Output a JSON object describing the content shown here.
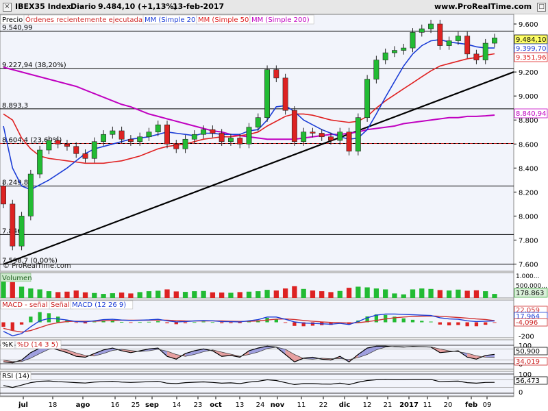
{
  "header": {
    "symbol": "IBEX35 Index",
    "period": "Diario",
    "last": "9.484,10 (+1,13%)",
    "date": "13-feb-2017",
    "site": "www.ProRealTime.com"
  },
  "watermark": "© ProRealTime.com",
  "price_panel": {
    "legend": {
      "precio": "Precio",
      "orders": "Órdenes recientemente ejecutadas",
      "mm20": "MM (Simple 20)",
      "mm50": "MM (Simple 50)",
      "mm200": "MM (Simple 200)"
    },
    "levels": [
      {
        "label": "9.540,99",
        "value": 9541
      },
      {
        "label": "9.227,94",
        "value": 9228,
        "fib": "(38,20%)"
      },
      {
        "label": "8.893,3",
        "value": 8893
      },
      {
        "label": "8.604,4",
        "value": 8604,
        "fib": "(23,60%)"
      },
      {
        "label": "8.249,89",
        "value": 8250
      },
      {
        "label": "7.846",
        "value": 7846
      },
      {
        "label": "7.598,7",
        "value": 7599,
        "fib": "(0,00%)"
      }
    ],
    "yticks": [
      "9.600",
      "9.400",
      "9.200",
      "9.000",
      "8.800",
      "8.600",
      "8.400",
      "8.200",
      "8.000",
      "7.800",
      "7.600"
    ],
    "value_tags": [
      {
        "text": "9.484,10",
        "color": "#000000",
        "bg": "#ffff66"
      },
      {
        "text": "9.399,70",
        "color": "#1a3cd6",
        "bg": "#ffffff"
      },
      {
        "text": "9.351,96",
        "color": "#e02020",
        "bg": "#ffffff"
      },
      {
        "text": "8.840,94",
        "color": "#c000c0",
        "bg": "#ffffff"
      }
    ]
  },
  "volume_panel": {
    "label": "Volumen",
    "yticks": [
      "1.000...",
      "500.000..."
    ],
    "value_tag": "178.863"
  },
  "macd_panel": {
    "legend": {
      "hist": "MACD - señal",
      "signal": "Señal",
      "macd": "MACD (12 26 9)"
    },
    "yticks": [
      "200",
      "0",
      "-200"
    ],
    "value_tags": [
      "22,059",
      "17,964",
      "-4,096"
    ]
  },
  "stoch_panel": {
    "legend": {
      "k": "%K",
      "d": "%D (14 3 5)"
    },
    "yticks": [
      "100",
      "0"
    ],
    "value_tags": [
      "50,900",
      "34,019"
    ]
  },
  "rsi_panel": {
    "legend": {
      "rsi": "RSI (14)"
    },
    "yticks": [
      "100",
      "0"
    ],
    "value_tag": "56,473"
  },
  "xaxis": {
    "labels": [
      "jul",
      "18",
      "ago",
      "16",
      "25",
      "sep",
      "14",
      "23",
      "oct",
      "13",
      "24",
      "nov",
      "11",
      "22",
      "dic",
      "12",
      "21",
      "2017",
      "11",
      "20",
      "feb",
      "09"
    ],
    "bold": [
      "jul",
      "ago",
      "sep",
      "oct",
      "nov",
      "dic",
      "2017",
      "feb"
    ]
  },
  "colors": {
    "up": "#22bb33",
    "down": "#dd2222",
    "mm20": "#1a3cd6",
    "mm50": "#e02020",
    "mm200": "#c000c0",
    "trend": "#000000"
  },
  "chart_data": {
    "type": "candlestick",
    "x": [
      "2016-06-27",
      "2016-06-30",
      "2016-07-05",
      "2016-07-08",
      "2016-07-13",
      "2016-07-18",
      "2016-07-21",
      "2016-07-26",
      "2016-07-29",
      "2016-08-03",
      "2016-08-08",
      "2016-08-11",
      "2016-08-16",
      "2016-08-19",
      "2016-08-24",
      "2016-08-29",
      "2016-09-01",
      "2016-09-06",
      "2016-09-09",
      "2016-09-14",
      "2016-09-19",
      "2016-09-22",
      "2016-09-27",
      "2016-09-30",
      "2016-10-05",
      "2016-10-10",
      "2016-10-13",
      "2016-10-18",
      "2016-10-21",
      "2016-10-26",
      "2016-10-31",
      "2016-11-03",
      "2016-11-08",
      "2016-11-11",
      "2016-11-16",
      "2016-11-21",
      "2016-11-24",
      "2016-11-29",
      "2016-12-02",
      "2016-12-07",
      "2016-12-12",
      "2016-12-15",
      "2016-12-20",
      "2016-12-23",
      "2016-12-29",
      "2017-01-04",
      "2017-01-09",
      "2017-01-12",
      "2017-01-17",
      "2017-01-20",
      "2017-01-25",
      "2017-01-30",
      "2017-02-02",
      "2017-02-07",
      "2017-02-13"
    ],
    "close": [
      8100,
      7750,
      8000,
      8350,
      8550,
      8630,
      8600,
      8580,
      8520,
      8480,
      8620,
      8680,
      8710,
      8640,
      8620,
      8660,
      8700,
      8760,
      8600,
      8560,
      8640,
      8680,
      8720,
      8690,
      8620,
      8650,
      8600,
      8740,
      8820,
      9220,
      9150,
      8880,
      8620,
      8700,
      8690,
      8660,
      8630,
      8700,
      8540,
      8820,
      9140,
      9300,
      9360,
      9380,
      9400,
      9530,
      9560,
      9600,
      9420,
      9460,
      9500,
      9350,
      9300,
      9440,
      9484
    ],
    "mm20": [
      8750,
      8400,
      8250,
      8220,
      8260,
      8300,
      8350,
      8400,
      8460,
      8520,
      8560,
      8580,
      8600,
      8620,
      8640,
      8650,
      8660,
      8680,
      8700,
      8690,
      8680,
      8670,
      8690,
      8690,
      8680,
      8680,
      8680,
      8710,
      8720,
      8800,
      8910,
      8920,
      8870,
      8800,
      8760,
      8720,
      8690,
      8660,
      8640,
      8650,
      8720,
      8850,
      8990,
      9120,
      9250,
      9350,
      9420,
      9460,
      9470,
      9450,
      9440,
      9430,
      9410,
      9400,
      9400
    ],
    "mm50": [
      8850,
      8800,
      8650,
      8560,
      8500,
      8480,
      8470,
      8460,
      8450,
      8440,
      8440,
      8440,
      8450,
      8460,
      8480,
      8500,
      8530,
      8560,
      8580,
      8590,
      8600,
      8620,
      8640,
      8650,
      8660,
      8660,
      8670,
      8680,
      8700,
      8750,
      8790,
      8830,
      8850,
      8850,
      8840,
      8820,
      8800,
      8790,
      8780,
      8790,
      8830,
      8900,
      8960,
      9010,
      9060,
      9110,
      9160,
      9210,
      9250,
      9270,
      9290,
      9310,
      9320,
      9340,
      9352
    ],
    "mm200": [
      9240,
      9220,
      9200,
      9180,
      9160,
      9140,
      9120,
      9100,
      9080,
      9050,
      9020,
      8990,
      8960,
      8930,
      8910,
      8880,
      8850,
      8830,
      8810,
      8790,
      8770,
      8750,
      8730,
      8710,
      8700,
      8680,
      8670,
      8660,
      8650,
      8640,
      8640,
      8640,
      8640,
      8650,
      8660,
      8670,
      8680,
      8680,
      8690,
      8700,
      8720,
      8730,
      8740,
      8750,
      8770,
      8780,
      8790,
      8800,
      8810,
      8820,
      8820,
      8830,
      8830,
      8835,
      8841
    ],
    "trendline": {
      "x": [
        "2016-06-27",
        "2017-02-13"
      ],
      "y": [
        7598.7,
        9140
      ]
    },
    "ylim": [
      7540,
      9680
    ],
    "volume": [
      900000,
      700000,
      500000,
      420000,
      380000,
      300000,
      260000,
      280000,
      330000,
      250000,
      220000,
      180000,
      210000,
      240000,
      200000,
      260000,
      300000,
      320000,
      380000,
      290000,
      270000,
      300000,
      310000,
      250000,
      240000,
      230000,
      260000,
      280000,
      300000,
      360000,
      330000,
      420000,
      520000,
      400000,
      330000,
      300000,
      260000,
      310000,
      450000,
      500000,
      470000,
      420000,
      380000,
      200000,
      160000,
      380000,
      420000,
      400000,
      350000,
      330000,
      370000,
      320000,
      340000,
      300000,
      178863
    ],
    "macd": [
      -120,
      -180,
      -150,
      -60,
      20,
      50,
      45,
      30,
      10,
      5,
      20,
      35,
      40,
      30,
      25,
      28,
      32,
      40,
      20,
      5,
      10,
      18,
      24,
      20,
      10,
      8,
      5,
      20,
      35,
      70,
      70,
      40,
      5,
      -10,
      -15,
      -20,
      -25,
      -15,
      -30,
      10,
      60,
      95,
      110,
      110,
      105,
      100,
      95,
      90,
      60,
      45,
      40,
      20,
      10,
      15,
      17.964
    ],
    "signal": [
      -80,
      -110,
      -130,
      -110,
      -70,
      -30,
      -5,
      10,
      15,
      15,
      15,
      20,
      25,
      28,
      28,
      27,
      28,
      30,
      28,
      22,
      18,
      17,
      18,
      19,
      18,
      15,
      12,
      13,
      18,
      30,
      42,
      45,
      37,
      25,
      15,
      5,
      -2,
      -5,
      -10,
      -6,
      8,
      25,
      45,
      60,
      70,
      78,
      82,
      84,
      80,
      72,
      64,
      55,
      45,
      37,
      22.059
    ],
    "stoch_k": [
      10,
      5,
      20,
      60,
      85,
      90,
      75,
      60,
      40,
      35,
      55,
      75,
      85,
      70,
      60,
      70,
      80,
      85,
      40,
      25,
      55,
      70,
      80,
      70,
      40,
      45,
      35,
      70,
      85,
      95,
      90,
      50,
      10,
      30,
      35,
      25,
      20,
      40,
      10,
      50,
      85,
      95,
      95,
      92,
      90,
      93,
      92,
      90,
      60,
      65,
      70,
      35,
      25,
      45,
      50.9
    ],
    "stoch_d": [
      20,
      12,
      12,
      30,
      55,
      78,
      85,
      75,
      58,
      45,
      42,
      55,
      72,
      78,
      72,
      66,
      70,
      78,
      68,
      50,
      40,
      50,
      65,
      75,
      63,
      52,
      40,
      50,
      63,
      82,
      90,
      78,
      50,
      28,
      25,
      30,
      27,
      28,
      23,
      33,
      50,
      75,
      90,
      94,
      92,
      91,
      92,
      91,
      80,
      70,
      65,
      57,
      43,
      35,
      34.019
    ],
    "rsi": [
      40,
      30,
      42,
      55,
      62,
      64,
      60,
      58,
      55,
      53,
      58,
      60,
      62,
      58,
      56,
      58,
      60,
      62,
      52,
      50,
      55,
      57,
      59,
      56,
      52,
      54,
      50,
      58,
      62,
      70,
      66,
      55,
      45,
      50,
      50,
      48,
      47,
      52,
      45,
      57,
      66,
      70,
      72,
      70,
      70,
      72,
      72,
      72,
      60,
      62,
      63,
      55,
      52,
      56,
      56.473
    ]
  }
}
